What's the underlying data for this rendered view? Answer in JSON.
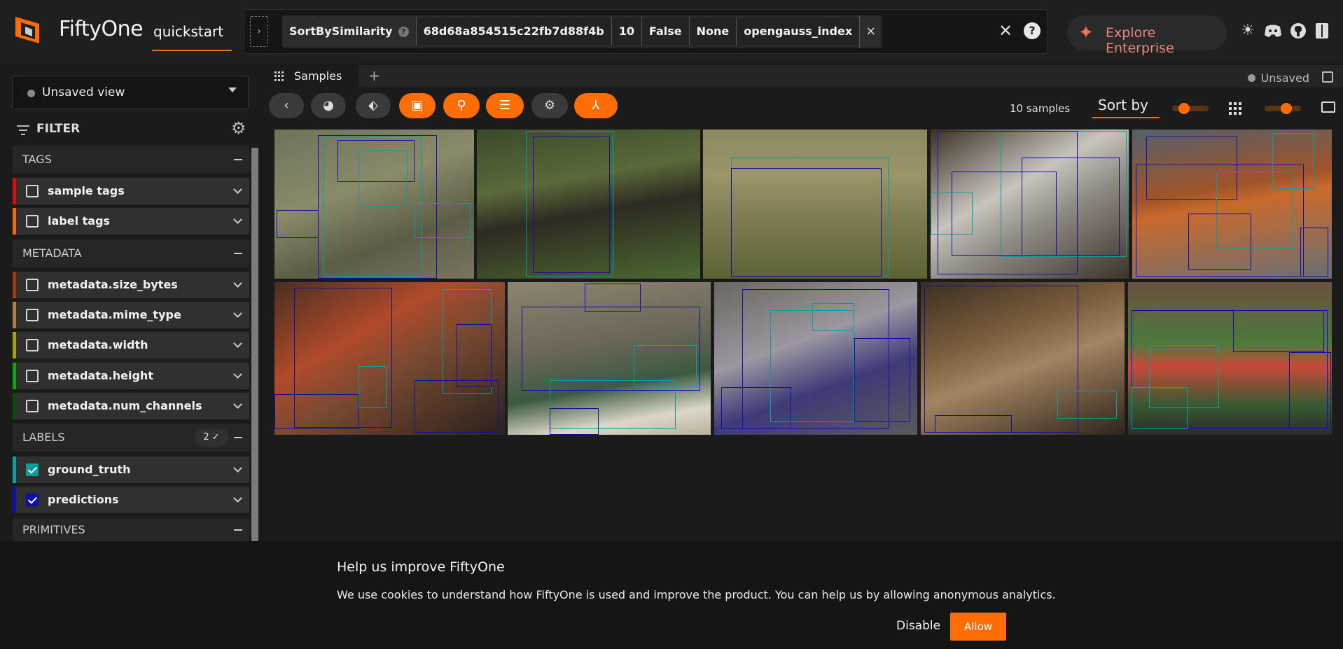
{
  "header": {
    "brand": "FiftyOne",
    "dataset": "quickstart",
    "view_stage": {
      "name": "SortBySimilarity",
      "args": [
        "68d68a854515c22fb7d88f4b",
        "10",
        "False",
        "None",
        "opengauss_index"
      ]
    },
    "enterprise_label": "Explore Enterprise",
    "icons": [
      "theme-toggle-icon",
      "discord-icon",
      "github-icon",
      "docs-icon"
    ]
  },
  "sidebar": {
    "view_select": "Unsaved view",
    "filter_label": "FILTER",
    "sections": {
      "tags": "TAGS",
      "metadata": "METADATA",
      "labels": "LABELS",
      "labels_badge": "2 ✓",
      "primitives": "PRIMITIVES"
    },
    "fields": [
      {
        "label": "sample tags",
        "color": "#d80e0e",
        "checked": false
      },
      {
        "label": "label tags",
        "color": "#ee6b0f",
        "checked": false
      },
      {
        "label": "metadata.size_bytes",
        "color": "#9b3d0e",
        "checked": false
      },
      {
        "label": "metadata.mime_type",
        "color": "#a8803d",
        "checked": false
      },
      {
        "label": "metadata.width",
        "color": "#a8a20e",
        "checked": false
      },
      {
        "label": "metadata.height",
        "color": "#13a30e",
        "checked": false
      },
      {
        "label": "metadata.num_channels",
        "color": "#0f4a0f",
        "checked": false
      },
      {
        "label": "ground_truth",
        "color": "#0b9c9c",
        "checked": true
      },
      {
        "label": "predictions",
        "color": "#1010a5",
        "checked": true
      }
    ]
  },
  "main": {
    "tab_label": "Samples",
    "unsaved_label": "Unsaved",
    "sample_count": "10 samples",
    "sort_label": "Sort by",
    "zoom_level": 0.25,
    "grid_size": 0.65
  },
  "cookie": {
    "title": "Help us improve FiftyOne",
    "text": "We use cookies to understand how FiftyOne is used and improve the product. You can help us by allowing anonymous analytics.",
    "disable_label": "Disable",
    "allow_label": "Allow"
  },
  "colors": {
    "accent": "#ff6d04",
    "ground_truth": "#0b9c9c",
    "predictions": "#1010a5"
  }
}
